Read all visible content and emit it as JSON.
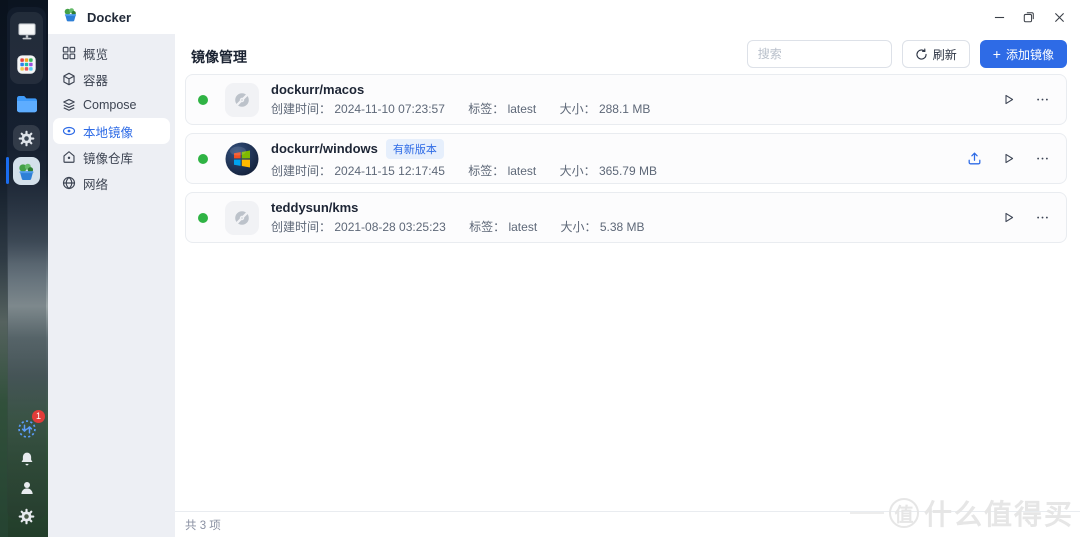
{
  "window": {
    "app_title": "Docker",
    "controls": {
      "minimize": "–",
      "close": "×"
    }
  },
  "dock": {
    "items_top": [
      {
        "name": "monitor"
      },
      {
        "name": "app-grid"
      }
    ],
    "items_mid": [
      {
        "name": "files"
      },
      {
        "name": "settings"
      },
      {
        "name": "docker",
        "active": true
      }
    ],
    "items_bottom": [
      {
        "name": "transfer",
        "badge": "1"
      },
      {
        "name": "notifications"
      },
      {
        "name": "user"
      },
      {
        "name": "system-settings"
      }
    ]
  },
  "sidebar": {
    "items": [
      {
        "label": "概览",
        "icon": "grid-icon",
        "active": false
      },
      {
        "label": "容器",
        "icon": "container-icon",
        "active": false
      },
      {
        "label": "Compose",
        "icon": "layers-icon",
        "active": false
      },
      {
        "label": "本地镜像",
        "icon": "disc-icon",
        "active": true
      },
      {
        "label": "镜像仓库",
        "icon": "repo-icon",
        "active": false
      },
      {
        "label": "网络",
        "icon": "globe-icon",
        "active": false
      }
    ]
  },
  "main": {
    "title": "镜像管理",
    "search_placeholder": "搜索",
    "refresh_label": "刷新",
    "add_plus": "+",
    "add_label": "添加镜像",
    "labels": {
      "created": "创建时间：",
      "tag": "标签：",
      "size": "大小："
    },
    "rows": [
      {
        "name": "dockurr/macos",
        "created": "2024-11-10 07:23:57",
        "tag": "latest",
        "size": "288.1 MB",
        "badge": null,
        "update": false,
        "icon": "placeholder",
        "status": "running"
      },
      {
        "name": "dockurr/windows",
        "created": "2024-11-15 12:17:45",
        "tag": "latest",
        "size": "365.79 MB",
        "badge": "有新版本",
        "update": true,
        "icon": "windows",
        "status": "running"
      },
      {
        "name": "teddysun/kms",
        "created": "2021-08-28 03:25:23",
        "tag": "latest",
        "size": "5.38 MB",
        "badge": null,
        "update": false,
        "icon": "placeholder",
        "status": "running"
      }
    ],
    "footer_total": "共 3 项"
  },
  "watermark": {
    "circle_text": "值",
    "text": "什么值得买"
  },
  "colors": {
    "accent": "#2e6be6",
    "status_green": "#2fb344",
    "badge_bg": "#e6effc",
    "badge_red": "#e23c39",
    "sidebar_bg": "#edeff4"
  }
}
